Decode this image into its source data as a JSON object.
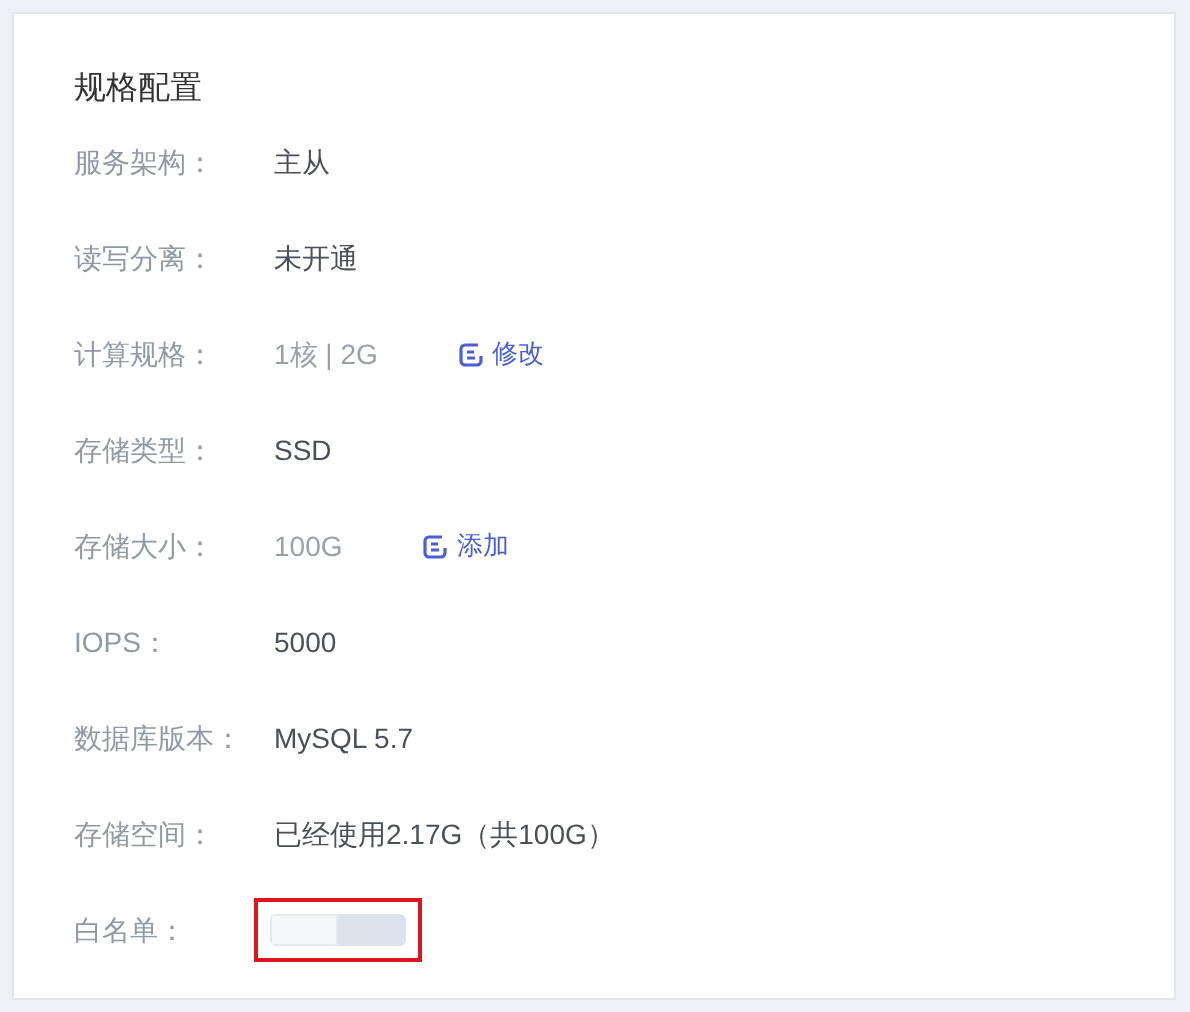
{
  "title": "规格配置",
  "rows": [
    {
      "kind": "text",
      "label": "服务架构：",
      "value": "主从",
      "muted": false
    },
    {
      "kind": "text",
      "label": "读写分离：",
      "value": "未开通",
      "muted": false
    },
    {
      "kind": "text",
      "label": "计算规格：",
      "value": "1核 | 2G",
      "muted": true,
      "action": "修改"
    },
    {
      "kind": "text",
      "label": "存储类型：",
      "value": "SSD",
      "muted": false
    },
    {
      "kind": "text",
      "label": "存储大小：",
      "value": "100G",
      "muted": true,
      "action": "添加"
    },
    {
      "kind": "text",
      "label": "IOPS：",
      "value": "5000",
      "muted": false
    },
    {
      "kind": "text",
      "label": "数据库版本：",
      "value": "MySQL 5.7",
      "muted": false
    },
    {
      "kind": "text",
      "label": "存储空间：",
      "value": "已经使用2.17G（共100G）",
      "muted": false
    },
    {
      "kind": "bar",
      "label": "白名单：",
      "level": 0.5,
      "highlighted": true
    }
  ]
}
